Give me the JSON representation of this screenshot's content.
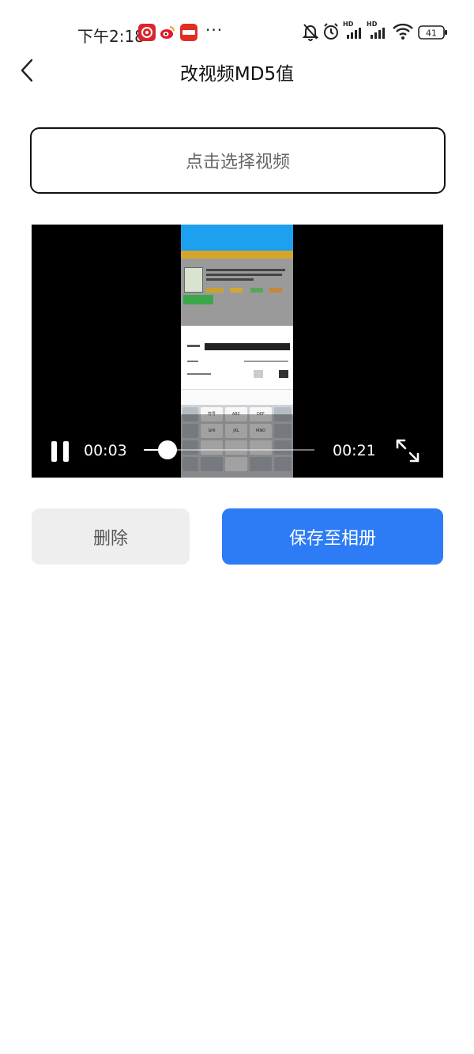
{
  "status_bar": {
    "time": "下午2:18",
    "battery": "41",
    "icons": [
      "app-red-icon",
      "weibo-icon",
      "pinduoduo-icon",
      "more-dots-icon",
      "bell-muted-icon",
      "alarm-icon",
      "hd-signal-icon",
      "hd-signal-icon",
      "wifi-icon",
      "battery-icon"
    ],
    "more": "···",
    "hd_label": "HD"
  },
  "header": {
    "title": "改视频MD5值",
    "back_icon": "chevron-left-icon"
  },
  "select_field": {
    "placeholder": "点击选择视频"
  },
  "video": {
    "current_time": "00:03",
    "total_time": "00:21",
    "progress": 0.14,
    "state": "playing",
    "frame_keys": [
      "符号",
      "ABC",
      "DEF",
      "GHI",
      "JKL",
      "MNO"
    ]
  },
  "actions": {
    "delete_label": "删除",
    "save_label": "保存至相册"
  },
  "colors": {
    "accent": "#2d7cf6",
    "delete_bg": "#eeeeee",
    "video_bg": "#000000"
  }
}
